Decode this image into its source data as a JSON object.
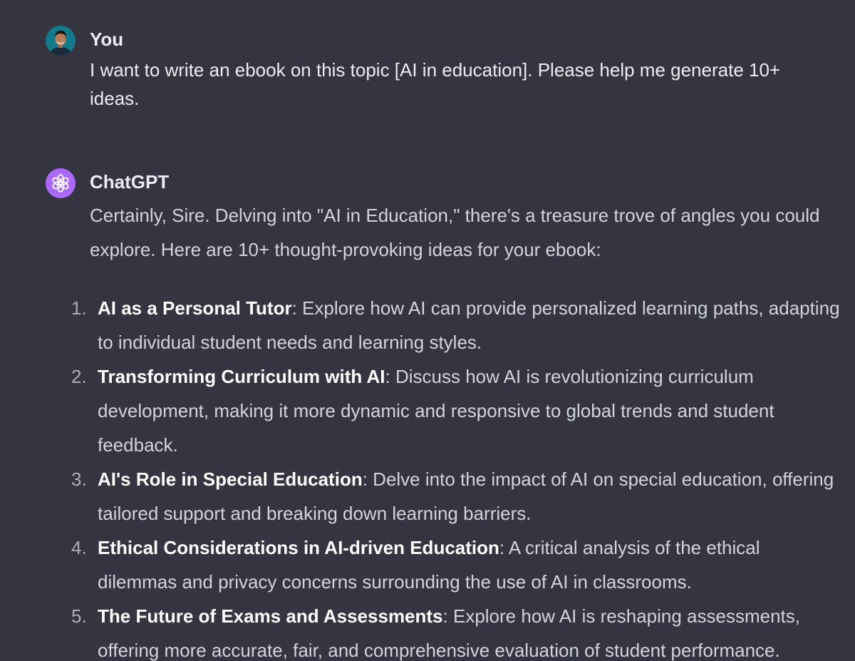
{
  "user_message": {
    "author": "You",
    "text": "I want to write an ebook on this topic [AI in education]. Please help me generate 10+ ideas."
  },
  "assistant_message": {
    "author": "ChatGPT",
    "intro": "Certainly, Sire. Delving into \"AI in Education,\" there's a treasure trove of angles you could explore. Here are 10+ thought-provoking ideas for your ebook:",
    "ideas": [
      {
        "number": "1.",
        "title": "AI as a Personal Tutor",
        "description": ": Explore how AI can provide personalized learning paths, adapting to individual student needs and learning styles."
      },
      {
        "number": "2.",
        "title": "Transforming Curriculum with AI",
        "description": ": Discuss how AI is revolutionizing curriculum development, making it more dynamic and responsive to global trends and student feedback."
      },
      {
        "number": "3.",
        "title": "AI's Role in Special Education",
        "description": ": Delve into the impact of AI on special education, offering tailored support and breaking down learning barriers."
      },
      {
        "number": "4.",
        "title": "Ethical Considerations in AI-driven Education",
        "description": ": A critical analysis of the ethical dilemmas and privacy concerns surrounding the use of AI in classrooms."
      },
      {
        "number": "5.",
        "title": "The Future of Exams and Assessments",
        "description": ": Explore how AI is reshaping assessments, offering more accurate, fair, and comprehensive evaluation of student performance."
      }
    ]
  },
  "icons": {
    "user_avatar": "user-avatar-photo",
    "assistant_avatar": "openai-logo-icon"
  },
  "colors": {
    "background": "#343541",
    "assistant_avatar_bg": "#ab68ff",
    "heading_text": "#ececf1",
    "body_text": "#d1d5db"
  }
}
